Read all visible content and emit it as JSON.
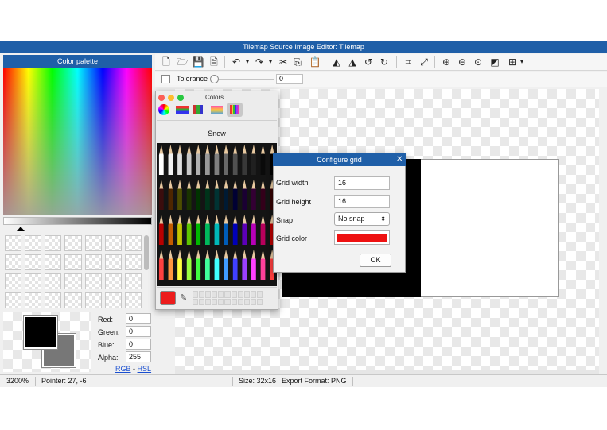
{
  "window": {
    "title": "Tilemap Source Image Editor: Tilemap"
  },
  "color_palette": {
    "title": "Color palette",
    "rgb": {
      "red_label": "Red:",
      "red": "0",
      "green_label": "Green:",
      "green": "0",
      "blue_label": "Blue:",
      "blue": "0",
      "alpha_label": "Alpha:",
      "alpha": "255"
    },
    "links": {
      "rgb": "RGB",
      "separator": "-",
      "hsl": "HSL"
    },
    "foreground_color": "#000000",
    "background_color": "#777777"
  },
  "toolbar": {
    "icons": [
      "new-file-icon",
      "open-folder-icon",
      "save-icon",
      "save-as-icon",
      "undo-icon",
      "undo-dropdown-icon",
      "redo-icon",
      "redo-dropdown-icon",
      "cut-icon",
      "copy-icon",
      "paste-icon",
      "flip-horizontal-icon",
      "flip-vertical-icon",
      "rotate-left-icon",
      "rotate-right-icon",
      "crop-icon",
      "resize-icon",
      "zoom-in-icon",
      "zoom-out-icon",
      "zoom-fit-icon",
      "toggle-background-icon",
      "grid-icon",
      "grid-dropdown-icon"
    ],
    "glyphs": [
      "🗋",
      "🗁",
      "💾",
      "🗎",
      "↶",
      "▾",
      "↷",
      "▾",
      "✂",
      "⎘",
      "📋",
      "◭",
      "◮",
      "↺",
      "↻",
      "⌗",
      "⤢",
      "⊕",
      "⊖",
      "⊙",
      "◩",
      "⊞",
      "▾"
    ],
    "tolerance_label": "Tolerance",
    "tolerance_value": "0"
  },
  "colors_dialog": {
    "title": "Colors",
    "mode_tabs": [
      "color-wheel-icon",
      "color-sliders-icon",
      "color-palettes-icon",
      "image-palettes-icon",
      "pencils-icon"
    ],
    "selected_name": "Snow",
    "current_color": "#ec1c1c"
  },
  "configure_grid": {
    "title": "Configure grid",
    "grid_width_label": "Grid width",
    "grid_width": "16",
    "grid_height_label": "Grid height",
    "grid_height": "16",
    "snap_label": "Snap",
    "snap_value": "No snap",
    "grid_color_label": "Grid color",
    "grid_color": "#ee1111",
    "ok_label": "OK"
  },
  "status_bar": {
    "zoom": "3200%",
    "pointer": "Pointer: 27, -6",
    "size": "Size: 32x16",
    "export_format": "Export Format: PNG"
  },
  "pencil_colors": [
    [
      "#ffffff",
      "#f2f2f2",
      "#e0e0e0",
      "#c8c8c8",
      "#b0b0b0",
      "#989898",
      "#808080",
      "#686868",
      "#505050",
      "#383838",
      "#202020",
      "#0a0a0a",
      "#000000"
    ],
    [
      "#3b0d0d",
      "#4d2600",
      "#4d4d00",
      "#1a3300",
      "#003300",
      "#00331a",
      "#003333",
      "#001a33",
      "#000033",
      "#1a0033",
      "#330033",
      "#33001a",
      "#330000"
    ],
    [
      "#b80000",
      "#c45c00",
      "#c4c400",
      "#5ec400",
      "#00b800",
      "#00b85c",
      "#00b8b8",
      "#005cb8",
      "#0000b8",
      "#5c00b8",
      "#b800b8",
      "#b8005c",
      "#b80000"
    ],
    [
      "#ff4040",
      "#ff9640",
      "#ffff40",
      "#9bff40",
      "#40ff40",
      "#40ff9b",
      "#40ffff",
      "#409bff",
      "#4040ff",
      "#9b40ff",
      "#ff40ff",
      "#ff409b",
      "#ff4040"
    ]
  ]
}
